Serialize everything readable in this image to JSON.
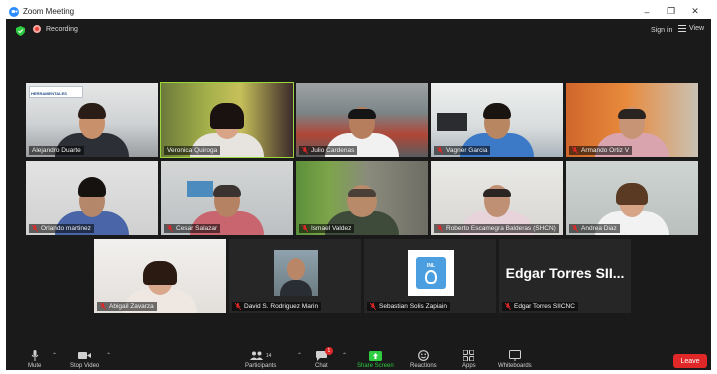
{
  "window": {
    "title": "Zoom Meeting",
    "minimize": "–",
    "maximize": "❐",
    "close": "✕"
  },
  "topbar": {
    "recording": "Recording",
    "sign_in": "Sign in",
    "view": "View"
  },
  "participants_row1": [
    {
      "name": "Alejandro Duarte",
      "mic": "on"
    },
    {
      "name": "Veronica Quiroga",
      "mic": "on",
      "active": true
    },
    {
      "name": "Julio Cardenas",
      "mic": "muted"
    },
    {
      "name": "Vagner Garcia",
      "mic": "muted"
    },
    {
      "name": "Armando Ortiz V",
      "mic": "muted"
    }
  ],
  "participants_row2": [
    {
      "name": "Orlando martinez",
      "mic": "muted"
    },
    {
      "name": "Cesar Salazar",
      "mic": "muted"
    },
    {
      "name": "Ismael Valdez",
      "mic": "muted"
    },
    {
      "name": "Roberto Escamegra Balderas (SHCN)",
      "mic": "muted"
    },
    {
      "name": "Andrea Diaz",
      "mic": "muted"
    }
  ],
  "participants_row3": [
    {
      "name": "Abigail Zavarza",
      "mic": "muted"
    },
    {
      "name": "David S. Rodriguez Marin",
      "mic": "muted"
    },
    {
      "name": "Sebastian Solis Zapiain",
      "mic": "muted"
    },
    {
      "name": "Edgar Torres SIICNC",
      "mic": "muted",
      "display": "Edgar Torres SII..."
    }
  ],
  "tile_banner": "HERRAMENTALES",
  "logo_badge": "INL",
  "toolbar": {
    "mute": "Mute",
    "stop_video": "Stop Video",
    "participants": "Participants",
    "participants_count": "14",
    "chat": "Chat",
    "chat_badge": "1",
    "share_screen": "Share Screen",
    "reactions": "Reactions",
    "apps": "Apps",
    "whiteboards": "Whiteboards",
    "leave": "Leave"
  },
  "colors": {
    "active_speaker": "#9ad53c",
    "leave": "#e02828",
    "share": "#2ecc40",
    "zoom_blue": "#2d8cff",
    "record_red": "#e8453c"
  }
}
